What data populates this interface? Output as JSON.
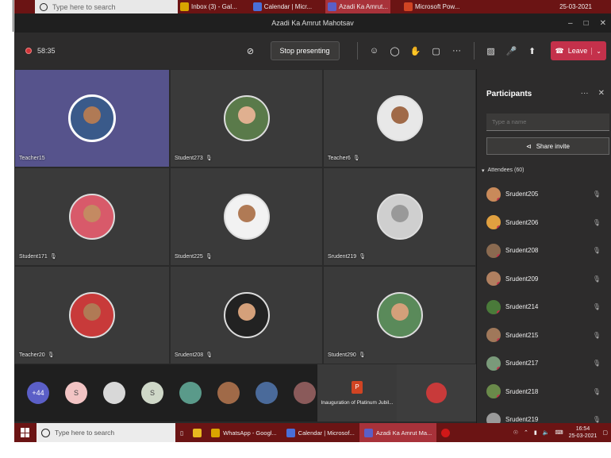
{
  "top_taskbar": {
    "search_placeholder": "Type here to search",
    "apps": [
      "Inbox (3) - Gal...",
      "Calendar | Micr...",
      "Azadi Ka Amrut...",
      "Microsoft Pow..."
    ],
    "date": "25-03-2021"
  },
  "window": {
    "title": "Azadi Ka Amrut Mahotsav"
  },
  "toolbar": {
    "timer": "58:35",
    "stop_presenting": "Stop presenting",
    "leave": "Leave"
  },
  "video_tiles": [
    {
      "name": "Teacher15",
      "muted": false,
      "highlighted": true,
      "bg": "#3a5a8a",
      "skin": "#b07a55"
    },
    {
      "name": "Student273",
      "muted": true,
      "highlighted": false,
      "bg": "#5a7a4a",
      "skin": "#e0b090"
    },
    {
      "name": "Teacher6",
      "muted": true,
      "highlighted": false,
      "bg": "#e8e8e8",
      "skin": "#a06a48"
    },
    {
      "name": "Student171",
      "muted": true,
      "highlighted": false,
      "bg": "#d85a6a",
      "skin": "#c48a62"
    },
    {
      "name": "Student225",
      "muted": true,
      "highlighted": false,
      "bg": "#f2f2f2",
      "skin": "#b07a55"
    },
    {
      "name": "Srudent219",
      "muted": true,
      "highlighted": false,
      "bg": "#cfcfcf",
      "skin": "#999999"
    },
    {
      "name": "Teacher20",
      "muted": true,
      "highlighted": false,
      "bg": "#c83a3a",
      "skin": "#b07a55"
    },
    {
      "name": "Srudent208",
      "muted": true,
      "highlighted": false,
      "bg": "#222222",
      "skin": "#d4a07a"
    },
    {
      "name": "Student290",
      "muted": true,
      "highlighted": false,
      "bg": "#5a8a5a",
      "skin": "#d4a07a"
    }
  ],
  "strip": {
    "more_count": "+44",
    "letters": [
      "S",
      "S"
    ],
    "share_label": "Inauguration of Platinum Jubil..."
  },
  "panel": {
    "title": "Participants",
    "search_placeholder": "Type a name",
    "share_invite": "Share invite",
    "attendees_heading": "Attendees (60)",
    "attendees": [
      {
        "name": "Srudent205",
        "color": "#c98a5a"
      },
      {
        "name": "Srudent206",
        "color": "#e0a040"
      },
      {
        "name": "Srudent208",
        "color": "#8a6a50"
      },
      {
        "name": "Srudent209",
        "color": "#b08060"
      },
      {
        "name": "Srudent214",
        "color": "#4a7a3a"
      },
      {
        "name": "Srudent215",
        "color": "#a0785a"
      },
      {
        "name": "Srudent217",
        "color": "#7a9a7a"
      },
      {
        "name": "Srudent218",
        "color": "#6a8a4a"
      },
      {
        "name": "Srudent219",
        "color": "#9a9a9a"
      }
    ]
  },
  "taskbar": {
    "search_placeholder": "Type here to search",
    "apps": [
      {
        "label": "WhatsApp - Googl...",
        "color": "#d9a400",
        "active": false
      },
      {
        "label": "Calendar | Microsof...",
        "color": "#4a6fd8",
        "active": false
      },
      {
        "label": "Azadi Ka Amrut Ma...",
        "color": "#5b5fc7",
        "active": true
      }
    ],
    "time": "16:54",
    "date": "25-03-2021"
  }
}
